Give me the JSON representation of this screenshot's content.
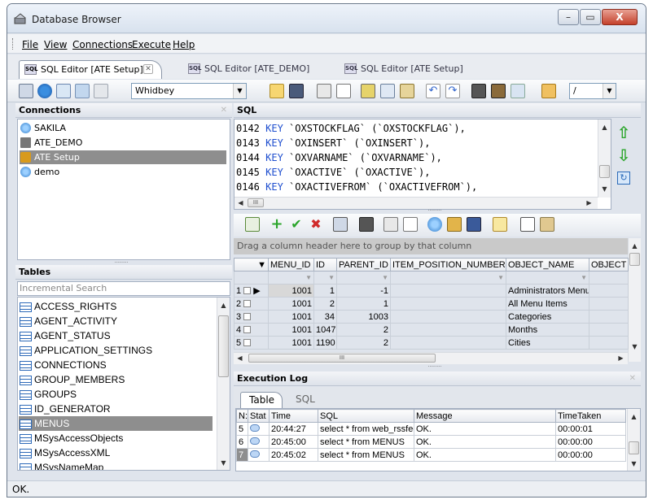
{
  "window": {
    "title": "Database Browser",
    "min": "–",
    "max": "▭",
    "close": "X"
  },
  "menu": [
    {
      "label": "File"
    },
    {
      "label": "View"
    },
    {
      "label": "Connections"
    },
    {
      "label": "Execute"
    },
    {
      "label": "Help"
    }
  ],
  "doc_tabs": [
    {
      "label": "SQL Editor [ATE Setup]",
      "active": true
    },
    {
      "label": "SQL Editor [ATE_DEMO]",
      "active": false
    },
    {
      "label": "SQL Editor [ATE Setup]",
      "active": false
    }
  ],
  "toolbar": {
    "connection_select": "Whidbey",
    "delimiter_select": "/"
  },
  "connections_pane": {
    "title": "Connections",
    "items": [
      {
        "label": "SAKILA",
        "icon": "db-blue-icon",
        "color": "#2a78c8"
      },
      {
        "label": "ATE_DEMO",
        "icon": "db-server-icon",
        "color": "#555555"
      },
      {
        "label": "ATE Setup",
        "icon": "db-tools-icon",
        "color": "#d89a1c",
        "selected": true
      },
      {
        "label": "demo",
        "icon": "db-blue-icon",
        "color": "#2a78c8"
      }
    ]
  },
  "tables_pane": {
    "title": "Tables",
    "search_placeholder": "Incremental Search",
    "items": [
      {
        "label": "ACCESS_RIGHTS"
      },
      {
        "label": "AGENT_ACTIVITY"
      },
      {
        "label": "AGENT_STATUS"
      },
      {
        "label": "APPLICATION_SETTINGS"
      },
      {
        "label": "CONNECTIONS"
      },
      {
        "label": "GROUP_MEMBERS"
      },
      {
        "label": "GROUPS"
      },
      {
        "label": "ID_GENERATOR"
      },
      {
        "label": "MENUS",
        "selected": true
      },
      {
        "label": "MSysAccessObjects"
      },
      {
        "label": "MSysAccessXML"
      },
      {
        "label": "MSysNameMap"
      }
    ]
  },
  "sql_pane": {
    "title": "SQL",
    "lines": [
      {
        "num": "0142",
        "kw": "KEY",
        "rest": " `OXSTOCKFLAG` (`OXSTOCKFLAG`),"
      },
      {
        "num": "0143",
        "kw": "KEY",
        "rest": " `OXINSERT` (`OXINSERT`),"
      },
      {
        "num": "0144",
        "kw": "KEY",
        "rest": " `OXVARNAME` (`OXVARNAME`),"
      },
      {
        "num": "0145",
        "kw": "KEY",
        "rest": " `OXACTIVE` (`OXACTIVE`),"
      },
      {
        "num": "0146",
        "kw": "KEY",
        "rest": " `OXACTIVEFROM` (`OXACTIVEFROM`),"
      }
    ],
    "hscroll_grip": "III"
  },
  "result_grid": {
    "group_hint": "Drag a column header here to group by that column",
    "columns": [
      "MENU_ID",
      "ID",
      "PARENT_ID",
      "ITEM_POSITION_NUMBER",
      "OBJECT_NAME",
      "OBJECT"
    ],
    "rows": [
      {
        "n": "1",
        "menu_id": "1001",
        "id": "1",
        "parent_id": "-1",
        "pos": "",
        "object_name": "Administrators Menu"
      },
      {
        "n": "2",
        "menu_id": "1001",
        "id": "2",
        "parent_id": "1",
        "pos": "",
        "object_name": "All Menu Items"
      },
      {
        "n": "3",
        "menu_id": "1001",
        "id": "34",
        "parent_id": "1003",
        "pos": "",
        "object_name": "Categories"
      },
      {
        "n": "4",
        "menu_id": "1001",
        "id": "1047",
        "parent_id": "2",
        "pos": "",
        "object_name": "Months"
      },
      {
        "n": "5",
        "menu_id": "1001",
        "id": "1190",
        "parent_id": "2",
        "pos": "",
        "object_name": "Cities"
      }
    ],
    "hscroll_grip": "III"
  },
  "exec_log": {
    "title": "Execution Log",
    "tabs": [
      {
        "label": "Table"
      },
      {
        "label": "SQL"
      }
    ],
    "columns": [
      "N:",
      "Stat",
      "Time",
      "SQL",
      "Message",
      "TimeTaken"
    ],
    "rows": [
      {
        "n": "5",
        "time": "20:44:27",
        "sql": "select * from web_rssfee",
        "message": "OK.",
        "taken": "00:00:01"
      },
      {
        "n": "6",
        "time": "20:45:00",
        "sql": "select * from MENUS",
        "message": "OK.",
        "taken": "00:00:00"
      },
      {
        "n": "7",
        "time": "20:45:02",
        "sql": "select * from MENUS",
        "message": "OK.",
        "taken": "00:00:00"
      }
    ]
  },
  "status": {
    "text": "OK."
  }
}
